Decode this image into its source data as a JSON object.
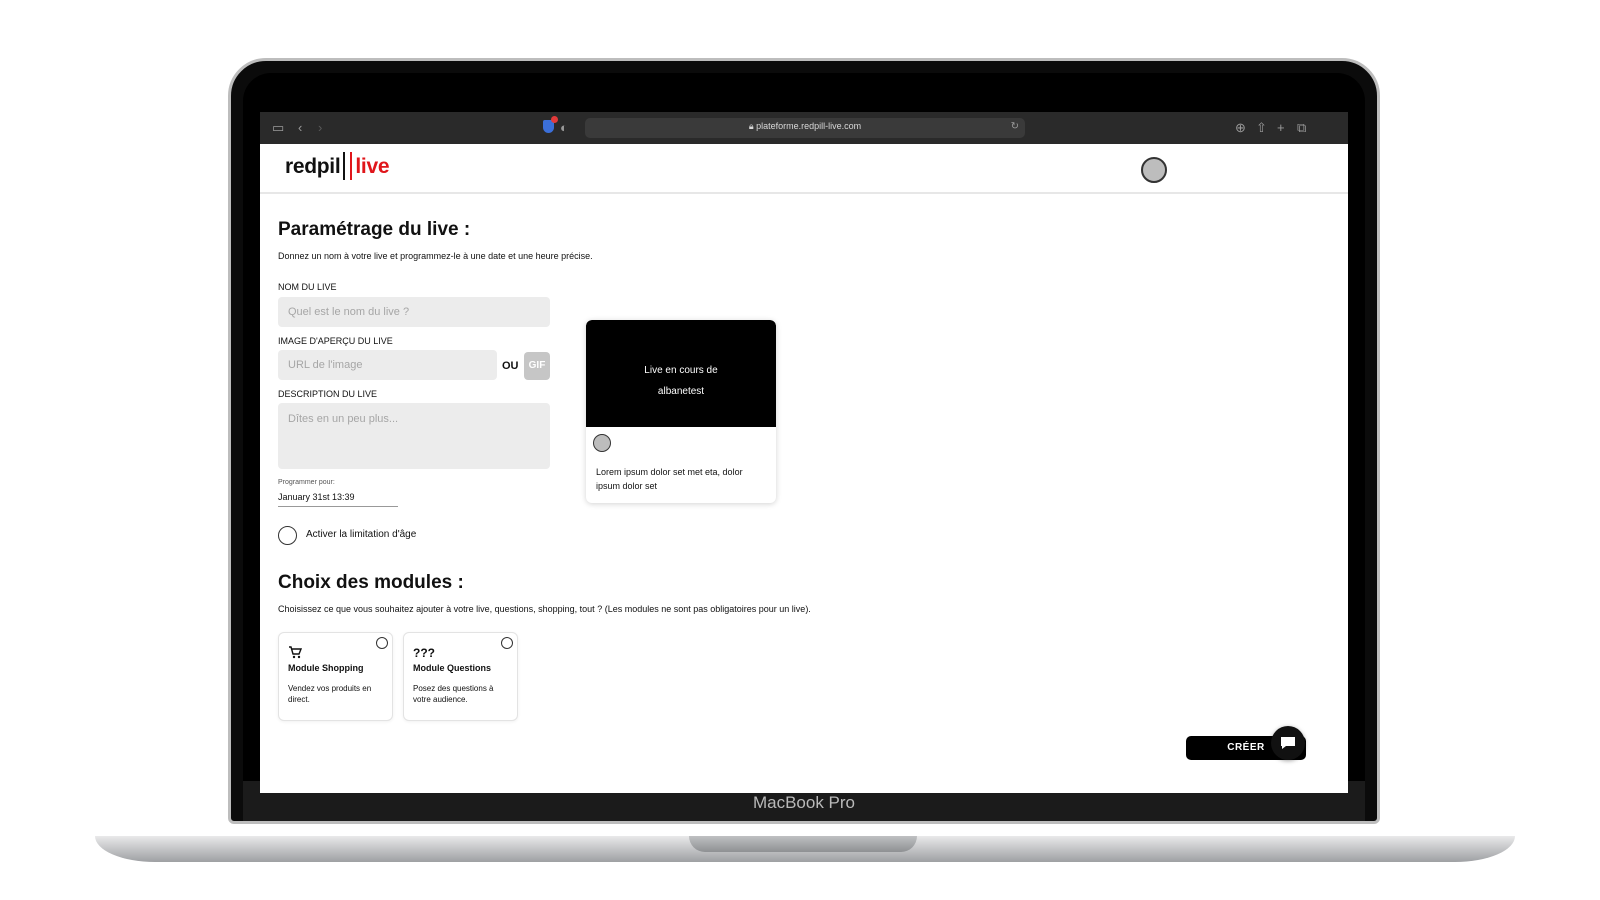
{
  "device": {
    "label": "MacBook Pro"
  },
  "browser": {
    "url": "plateforme.redpill-live.com"
  },
  "brand": {
    "part1": "redpil",
    "part2": "live",
    "accent": "#e0161b"
  },
  "setup": {
    "title": "Paramétrage du live :",
    "subtitle": "Donnez un nom à votre live et programmez-le à une date et une heure précise.",
    "name_label": "NOM DU LIVE",
    "name_placeholder": "Quel est le nom du live ?",
    "image_label": "IMAGE D'APERÇU DU LIVE",
    "image_placeholder": "URL de l'image",
    "or_label": "OU",
    "gif_label": "GIF",
    "desc_label": "DESCRIPTION DU LIVE",
    "desc_placeholder": "Dîtes en un peu plus...",
    "schedule_label": "Programmer pour:",
    "schedule_value": "January 31st 13:39",
    "age_limit_label": "Activer la limitation d'âge"
  },
  "preview": {
    "title_line1": "Live en cours de",
    "title_line2": "albanetest",
    "description": "Lorem ipsum dolor set met eta, dolor ipsum dolor set"
  },
  "modules": {
    "title": "Choix des modules :",
    "subtitle": "Choisissez ce que vous souhaitez ajouter à votre live, questions, shopping, tout ? (Les modules ne sont pas obligatoires pour un live).",
    "items": [
      {
        "icon": "cart-icon",
        "title": "Module Shopping",
        "desc": "Vendez vos produits en direct."
      },
      {
        "icon": "question-marks-icon",
        "icon_text": "???",
        "title": "Module Questions",
        "desc": "Posez des questions à votre audience."
      }
    ]
  },
  "actions": {
    "create_label": "CRÉER"
  }
}
